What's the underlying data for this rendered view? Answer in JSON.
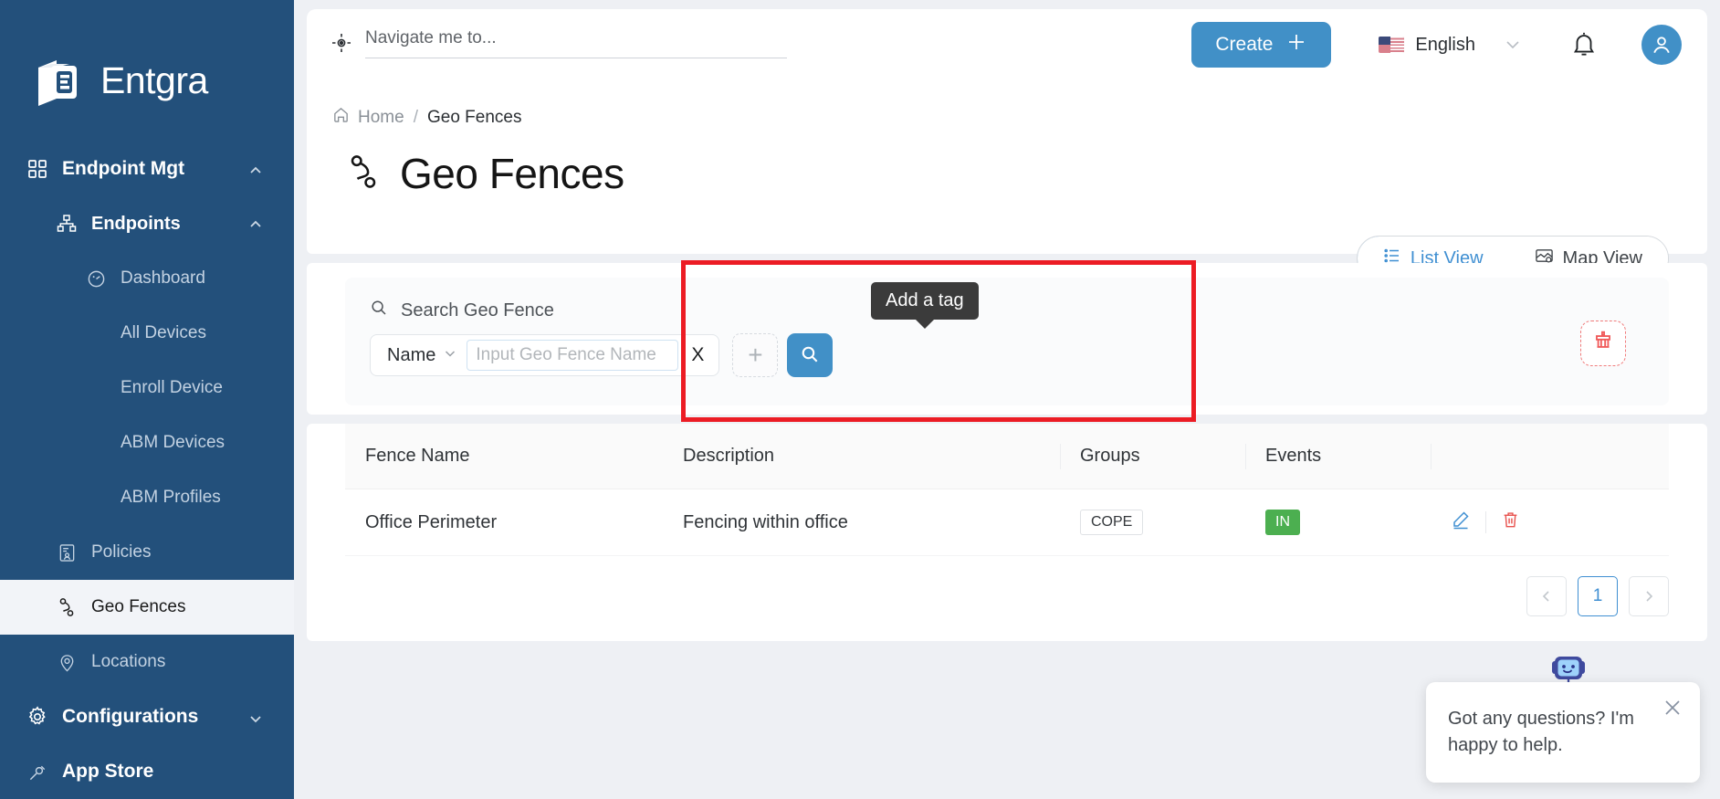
{
  "brand": {
    "name": "Entgra",
    "logo_icon": "entgra-logo-icon"
  },
  "sidebar": {
    "items": [
      {
        "label": "Endpoint Mgt",
        "icon": "grid-icon",
        "level": 0,
        "chevron": "chevron-up-icon",
        "active": false
      },
      {
        "label": "Endpoints",
        "icon": "sitemap-icon",
        "level": 1,
        "chevron": "chevron-up-icon",
        "active": false
      },
      {
        "label": "Dashboard",
        "icon": "gauge-icon",
        "level": 2,
        "active": false
      },
      {
        "label": "All Devices",
        "icon": "",
        "level": 2,
        "active": false
      },
      {
        "label": "Enroll Device",
        "icon": "",
        "level": 2,
        "active": false
      },
      {
        "label": "ABM Devices",
        "icon": "",
        "level": 2,
        "active": false
      },
      {
        "label": "ABM Profiles",
        "icon": "",
        "level": 2,
        "active": false
      },
      {
        "label": "Policies",
        "icon": "policy-icon",
        "level": 1,
        "active": false
      },
      {
        "label": "Geo Fences",
        "icon": "geofence-icon",
        "level": 1,
        "active": true
      },
      {
        "label": "Locations",
        "icon": "location-pin-icon",
        "level": 1,
        "active": false
      },
      {
        "label": "Configurations",
        "icon": "gear-icon",
        "level": 0,
        "chevron": "chevron-down-icon",
        "active": false
      },
      {
        "label": "App Store",
        "icon": "app-store-icon",
        "level": 0,
        "active": false
      }
    ]
  },
  "topbar": {
    "nav_search_placeholder": "Navigate me to...",
    "nav_search_value": "",
    "nav_search_icon": "navigate-target-icon",
    "create_label": "Create",
    "create_icon": "plus-icon",
    "language": "English",
    "language_flag": "us-flag-icon",
    "language_chevron": "chevron-down-icon",
    "notification_icon": "bell-icon",
    "avatar_icon": "user-avatar-icon"
  },
  "breadcrumb": {
    "home_label": "Home",
    "home_icon": "home-icon",
    "separator": "/",
    "current": "Geo Fences"
  },
  "page": {
    "title": "Geo Fences",
    "title_icon": "geofence-icon"
  },
  "view_toggle": {
    "list_label": "List View",
    "list_icon": "list-icon",
    "map_label": "Map View",
    "map_icon": "map-icon",
    "selected": "List View"
  },
  "search_panel": {
    "title": "Search Geo Fence",
    "title_icon": "search-icon",
    "field_select": "Name",
    "field_select_chevron": "chevron-down-icon",
    "input_placeholder": "Input Geo Fence Name",
    "input_value": "",
    "clear_label": "X",
    "add_label": "+",
    "add_icon": "plus-icon",
    "search_icon": "search-icon",
    "clear_all_icon": "broom-clear-icon",
    "tooltip": "Add a tag"
  },
  "table": {
    "columns": [
      "Fence Name",
      "Description",
      "Groups",
      "Events",
      ""
    ],
    "rows": [
      {
        "fence_name": "Office Perimeter",
        "description": "Fencing within office",
        "groups": [
          "COPE"
        ],
        "events": [
          "IN"
        ],
        "edit_icon": "pencil-edit-icon",
        "delete_icon": "trash-delete-icon"
      }
    ]
  },
  "pagination": {
    "prev_icon": "chevron-left-icon",
    "next_icon": "chevron-right-icon",
    "pages": [
      "1"
    ],
    "current": "1"
  },
  "chat_widget": {
    "message": "Got any questions? I'm happy to help.",
    "close_icon": "close-icon",
    "bot_icon": "chat-bot-icon"
  },
  "colors": {
    "sidebar_bg": "#23507b",
    "accent_blue": "#4190c7",
    "highlight_red": "#ec1c24",
    "event_green": "#4caf50",
    "page_bg": "#eef0f4"
  }
}
